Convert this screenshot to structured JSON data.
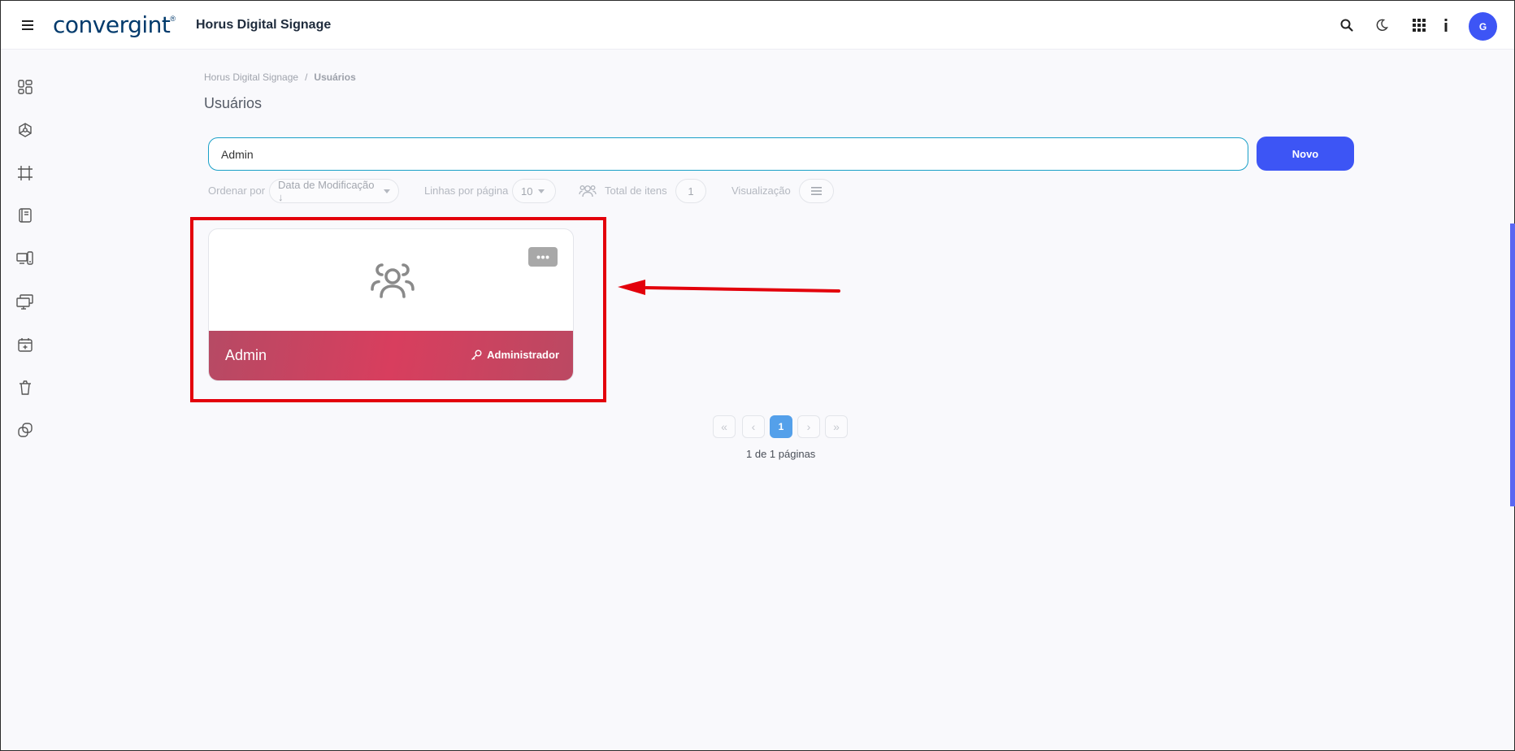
{
  "header": {
    "logo_text": "convergint",
    "logo_mark": "®",
    "app_title": "Horus Digital Signage",
    "avatar_initial": "G",
    "icons": [
      "menu-icon",
      "search-icon",
      "moon-icon",
      "apps-grid-icon",
      "info-icon"
    ]
  },
  "sidebar": {
    "items": [
      {
        "icon": "dashboard-icon"
      },
      {
        "icon": "hub-icon"
      },
      {
        "icon": "frame-icon"
      },
      {
        "icon": "content-icon"
      },
      {
        "icon": "devices-icon"
      },
      {
        "icon": "screens-icon"
      },
      {
        "icon": "calendar-add-icon"
      },
      {
        "icon": "trash-icon"
      },
      {
        "icon": "copy-link-icon"
      }
    ]
  },
  "breadcrumb": {
    "root": "Horus Digital Signage",
    "separator": "/",
    "current": "Usuários"
  },
  "page": {
    "title": "Usuários"
  },
  "search": {
    "value": "Admin",
    "new_button": "Novo"
  },
  "toolbar": {
    "sort_label": "Ordenar por",
    "sort_value": "Data de Modificação ↓",
    "rows_label": "Linhas por página",
    "rows_value": "10",
    "total_label": "Total de itens",
    "total_value": "1",
    "view_label": "Visualização"
  },
  "cards": [
    {
      "name": "Admin",
      "role": "Administrador",
      "icon": "users-group-icon"
    }
  ],
  "pagination": {
    "first": "«",
    "prev": "‹",
    "current": "1",
    "next": "›",
    "last": "»",
    "info": "1 de 1 páginas"
  },
  "colors": {
    "primary": "#3d55f5",
    "card_footer": "#d83e5e",
    "highlight": "#e3000b",
    "active_page": "#54a0ea"
  }
}
